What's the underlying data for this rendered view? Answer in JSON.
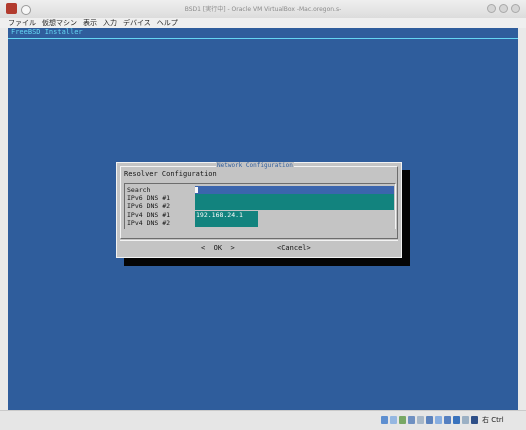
{
  "window": {
    "title": "BSD1 [実行中] - Oracle VM VirtualBox -Mac.oregon.s-",
    "controls": [
      "minimize-button",
      "maximize-button",
      "close-button"
    ]
  },
  "menu": [
    "ファイル",
    "仮想マシン",
    "表示",
    "入力",
    "デバイス",
    "ヘルプ"
  ],
  "vm": {
    "installer_title": "FreeBSD Installer",
    "dialog": {
      "title": "Network Configuration",
      "heading": "Resolver Configuration",
      "fields": [
        {
          "label": "Search",
          "value": ""
        },
        {
          "label": "IPv6 DNS #1",
          "value": ""
        },
        {
          "label": "IPv6 DNS #2",
          "value": ""
        },
        {
          "label": "IPv4 DNS #1",
          "value": "192.168.24.1"
        },
        {
          "label": "IPv4 DNS #2",
          "value": ""
        }
      ],
      "ok_label": "<  OK  >",
      "cancel_label": "<Cancel>"
    }
  },
  "statusbar": {
    "host_key": "右 Ctrl"
  },
  "colors": {
    "desktop": "#2f5d9c",
    "accent": "#65d6f3",
    "dialog_bg": "#c4c4c4",
    "field_active": "#3b65ad",
    "field_inactive": "#12837e"
  }
}
